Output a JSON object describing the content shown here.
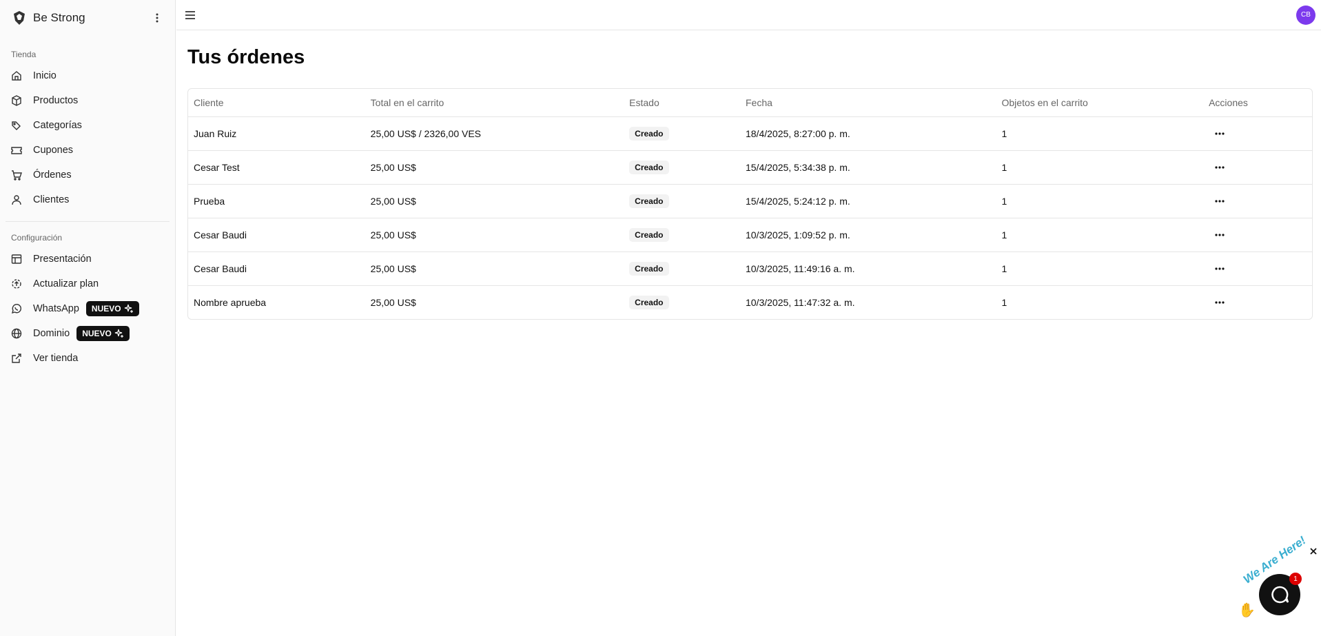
{
  "brand": {
    "name": "Be Strong"
  },
  "sidebar": {
    "groups": [
      {
        "label": "Tienda",
        "items": [
          {
            "label": "Inicio",
            "icon": "home-icon"
          },
          {
            "label": "Productos",
            "icon": "package-icon"
          },
          {
            "label": "Categorías",
            "icon": "tags-icon"
          },
          {
            "label": "Cupones",
            "icon": "ticket-icon"
          },
          {
            "label": "Órdenes",
            "icon": "cart-icon"
          },
          {
            "label": "Clientes",
            "icon": "user-icon"
          }
        ]
      },
      {
        "label": "Configuración",
        "items": [
          {
            "label": "Presentación",
            "icon": "layout-icon"
          },
          {
            "label": "Actualizar plan",
            "icon": "upgrade-icon"
          },
          {
            "label": "WhatsApp",
            "icon": "whatsapp-icon",
            "badge": "NUEVO"
          },
          {
            "label": "Dominio",
            "icon": "globe-icon",
            "badge": "NUEVO"
          },
          {
            "label": "Ver tienda",
            "icon": "external-link-icon"
          }
        ]
      }
    ]
  },
  "topbar": {
    "avatar_initials": "CB"
  },
  "page": {
    "title": "Tus órdenes"
  },
  "table": {
    "headers": [
      "Cliente",
      "Total en el carrito",
      "Estado",
      "Fecha",
      "Objetos en el carrito",
      "Acciones"
    ],
    "rows": [
      {
        "cliente": "Juan Ruiz",
        "total": "25,00 US$ / 2326,00 VES",
        "estado": "Creado",
        "fecha": "18/4/2025, 8:27:00 p. m.",
        "objetos": "1"
      },
      {
        "cliente": "Cesar Test",
        "total": "25,00 US$",
        "estado": "Creado",
        "fecha": "15/4/2025, 5:34:38 p. m.",
        "objetos": "1"
      },
      {
        "cliente": "Prueba",
        "total": "25,00 US$",
        "estado": "Creado",
        "fecha": "15/4/2025, 5:24:12 p. m.",
        "objetos": "1"
      },
      {
        "cliente": "Cesar Baudi",
        "total": "25,00 US$",
        "estado": "Creado",
        "fecha": "10/3/2025, 1:09:52 p. m.",
        "objetos": "1"
      },
      {
        "cliente": "Cesar Baudi",
        "total": "25,00 US$",
        "estado": "Creado",
        "fecha": "10/3/2025, 11:49:16 a. m.",
        "objetos": "1"
      },
      {
        "cliente": "Nombre aprueba",
        "total": "25,00 US$",
        "estado": "Creado",
        "fecha": "10/3/2025, 11:47:32 a. m.",
        "objetos": "1"
      }
    ]
  },
  "chat_widget": {
    "text": "We Are Here!",
    "count": "1"
  },
  "colors": {
    "avatar": "#7c3aed",
    "badge": "#111111",
    "chat_count": "#dd0000"
  }
}
